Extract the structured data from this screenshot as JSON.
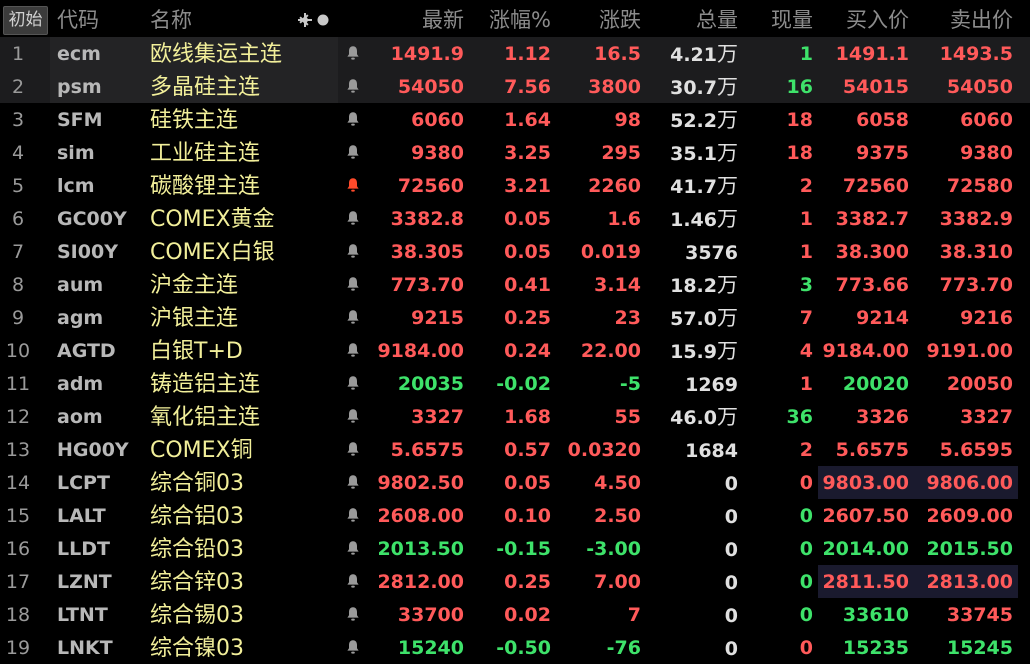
{
  "header": {
    "reset_label": "初始",
    "columns": {
      "code": "代码",
      "name": "名称",
      "last": "最新",
      "pct": "涨幅%",
      "chg": "涨跌",
      "vol": "总量",
      "cur": "现量",
      "bid": "买入价",
      "ask": "卖出价"
    }
  },
  "colors": {
    "up": "#ff5a5a",
    "down": "#3ee26a",
    "flat": "#e6e6e6",
    "name": "#f2ef9a",
    "bell": "#9a9a9a",
    "bell_active": "#ff4a2a"
  },
  "rows": [
    {
      "idx": "1",
      "code": "ecm",
      "name": "欧线集运主连",
      "alert": "off",
      "last": "1491.9",
      "pct": "1.12",
      "chg": "16.5",
      "vol": "4.21",
      "unit": "万",
      "cur": "1",
      "bid": "1491.1",
      "ask": "1493.5",
      "dir": "up",
      "cur_dir": "dn",
      "bid_dir": "up",
      "ask_dir": "up",
      "highlight": true,
      "bidask_bg": false
    },
    {
      "idx": "2",
      "code": "psm",
      "name": "多晶硅主连",
      "alert": "off",
      "last": "54050",
      "pct": "7.56",
      "chg": "3800",
      "vol": "30.7",
      "unit": "万",
      "cur": "16",
      "bid": "54015",
      "ask": "54050",
      "dir": "up",
      "cur_dir": "dn",
      "bid_dir": "up",
      "ask_dir": "up",
      "highlight": true,
      "bidask_bg": false
    },
    {
      "idx": "3",
      "code": "SFM",
      "name": "硅铁主连",
      "alert": "off",
      "last": "6060",
      "pct": "1.64",
      "chg": "98",
      "vol": "52.2",
      "unit": "万",
      "cur": "18",
      "bid": "6058",
      "ask": "6060",
      "dir": "up",
      "cur_dir": "up",
      "bid_dir": "up",
      "ask_dir": "up",
      "highlight": false,
      "bidask_bg": false
    },
    {
      "idx": "4",
      "code": "sim",
      "name": "工业硅主连",
      "alert": "off",
      "last": "9380",
      "pct": "3.25",
      "chg": "295",
      "vol": "35.1",
      "unit": "万",
      "cur": "18",
      "bid": "9375",
      "ask": "9380",
      "dir": "up",
      "cur_dir": "up",
      "bid_dir": "up",
      "ask_dir": "up",
      "highlight": false,
      "bidask_bg": false
    },
    {
      "idx": "5",
      "code": "lcm",
      "name": "碳酸锂主连",
      "alert": "on",
      "last": "72560",
      "pct": "3.21",
      "chg": "2260",
      "vol": "41.7",
      "unit": "万",
      "cur": "2",
      "bid": "72560",
      "ask": "72580",
      "dir": "up",
      "cur_dir": "up",
      "bid_dir": "up",
      "ask_dir": "up",
      "highlight": false,
      "bidask_bg": false
    },
    {
      "idx": "6",
      "code": "GC00Y",
      "name": "COMEX黄金",
      "alert": "off",
      "last": "3382.8",
      "pct": "0.05",
      "chg": "1.6",
      "vol": "1.46",
      "unit": "万",
      "cur": "1",
      "bid": "3382.7",
      "ask": "3382.9",
      "dir": "up",
      "cur_dir": "up",
      "bid_dir": "up",
      "ask_dir": "up",
      "highlight": false,
      "bidask_bg": false
    },
    {
      "idx": "7",
      "code": "SI00Y",
      "name": "COMEX白银",
      "alert": "off",
      "last": "38.305",
      "pct": "0.05",
      "chg": "0.019",
      "vol": "3576",
      "unit": "",
      "cur": "1",
      "bid": "38.300",
      "ask": "38.310",
      "dir": "up",
      "cur_dir": "up",
      "bid_dir": "up",
      "ask_dir": "up",
      "highlight": false,
      "bidask_bg": false
    },
    {
      "idx": "8",
      "code": "aum",
      "name": "沪金主连",
      "alert": "off",
      "last": "773.70",
      "pct": "0.41",
      "chg": "3.14",
      "vol": "18.2",
      "unit": "万",
      "cur": "3",
      "bid": "773.66",
      "ask": "773.70",
      "dir": "up",
      "cur_dir": "dn",
      "bid_dir": "up",
      "ask_dir": "up",
      "highlight": false,
      "bidask_bg": false
    },
    {
      "idx": "9",
      "code": "agm",
      "name": "沪银主连",
      "alert": "off",
      "last": "9215",
      "pct": "0.25",
      "chg": "23",
      "vol": "57.0",
      "unit": "万",
      "cur": "7",
      "bid": "9214",
      "ask": "9216",
      "dir": "up",
      "cur_dir": "up",
      "bid_dir": "up",
      "ask_dir": "up",
      "highlight": false,
      "bidask_bg": false
    },
    {
      "idx": "10",
      "code": "AGTD",
      "name": "白银T+D",
      "alert": "off",
      "last": "9184.00",
      "pct": "0.24",
      "chg": "22.00",
      "vol": "15.9",
      "unit": "万",
      "cur": "4",
      "bid": "9184.00",
      "ask": "9191.00",
      "dir": "up",
      "cur_dir": "up",
      "bid_dir": "up",
      "ask_dir": "up",
      "highlight": false,
      "bidask_bg": false
    },
    {
      "idx": "11",
      "code": "adm",
      "name": "铸造铝主连",
      "alert": "off",
      "last": "20035",
      "pct": "-0.02",
      "chg": "-5",
      "vol": "1269",
      "unit": "",
      "cur": "1",
      "bid": "20020",
      "ask": "20050",
      "dir": "dn",
      "cur_dir": "up",
      "bid_dir": "dn",
      "ask_dir": "up",
      "highlight": false,
      "bidask_bg": false
    },
    {
      "idx": "12",
      "code": "aom",
      "name": "氧化铝主连",
      "alert": "off",
      "last": "3327",
      "pct": "1.68",
      "chg": "55",
      "vol": "46.0",
      "unit": "万",
      "cur": "36",
      "bid": "3326",
      "ask": "3327",
      "dir": "up",
      "cur_dir": "dn",
      "bid_dir": "up",
      "ask_dir": "up",
      "highlight": false,
      "bidask_bg": false
    },
    {
      "idx": "13",
      "code": "HG00Y",
      "name": "COMEX铜",
      "alert": "off",
      "last": "5.6575",
      "pct": "0.57",
      "chg": "0.0320",
      "vol": "1684",
      "unit": "",
      "cur": "2",
      "bid": "5.6575",
      "ask": "5.6595",
      "dir": "up",
      "cur_dir": "up",
      "bid_dir": "up",
      "ask_dir": "up",
      "highlight": false,
      "bidask_bg": false
    },
    {
      "idx": "14",
      "code": "LCPT",
      "name": "综合铜03",
      "alert": "off",
      "last": "9802.50",
      "pct": "0.05",
      "chg": "4.50",
      "vol": "0",
      "unit": "",
      "cur": "0",
      "bid": "9803.00",
      "ask": "9806.00",
      "dir": "up",
      "cur_dir": "up",
      "bid_dir": "up",
      "ask_dir": "up",
      "highlight": false,
      "bidask_bg": true
    },
    {
      "idx": "15",
      "code": "LALT",
      "name": "综合铝03",
      "alert": "off",
      "last": "2608.00",
      "pct": "0.10",
      "chg": "2.50",
      "vol": "0",
      "unit": "",
      "cur": "0",
      "bid": "2607.50",
      "ask": "2609.00",
      "dir": "up",
      "cur_dir": "dn",
      "bid_dir": "up",
      "ask_dir": "up",
      "highlight": false,
      "bidask_bg": false
    },
    {
      "idx": "16",
      "code": "LLDT",
      "name": "综合铅03",
      "alert": "off",
      "last": "2013.50",
      "pct": "-0.15",
      "chg": "-3.00",
      "vol": "0",
      "unit": "",
      "cur": "0",
      "bid": "2014.00",
      "ask": "2015.50",
      "dir": "dn",
      "cur_dir": "dn",
      "bid_dir": "dn",
      "ask_dir": "dn",
      "highlight": false,
      "bidask_bg": false
    },
    {
      "idx": "17",
      "code": "LZNT",
      "name": "综合锌03",
      "alert": "off",
      "last": "2812.00",
      "pct": "0.25",
      "chg": "7.00",
      "vol": "0",
      "unit": "",
      "cur": "0",
      "bid": "2811.50",
      "ask": "2813.00",
      "dir": "up",
      "cur_dir": "dn",
      "bid_dir": "up",
      "ask_dir": "up",
      "highlight": false,
      "bidask_bg": true
    },
    {
      "idx": "18",
      "code": "LTNT",
      "name": "综合锡03",
      "alert": "off",
      "last": "33700",
      "pct": "0.02",
      "chg": "7",
      "vol": "0",
      "unit": "",
      "cur": "0",
      "bid": "33610",
      "ask": "33745",
      "dir": "up",
      "cur_dir": "dn",
      "bid_dir": "dn",
      "ask_dir": "up",
      "highlight": false,
      "bidask_bg": false
    },
    {
      "idx": "19",
      "code": "LNKT",
      "name": "综合镍03",
      "alert": "off",
      "last": "15240",
      "pct": "-0.50",
      "chg": "-76",
      "vol": "0",
      "unit": "",
      "cur": "0",
      "bid": "15235",
      "ask": "15245",
      "dir": "dn",
      "cur_dir": "up",
      "bid_dir": "dn",
      "ask_dir": "dn",
      "highlight": false,
      "bidask_bg": false
    }
  ]
}
